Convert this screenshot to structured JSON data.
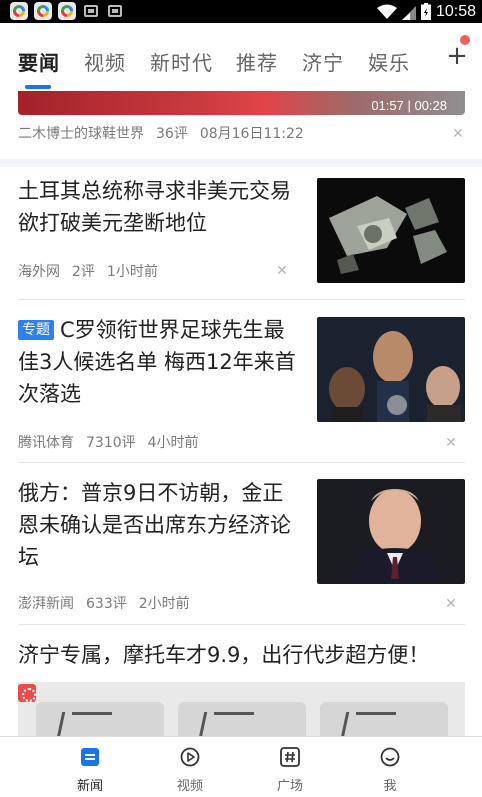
{
  "status_bar": {
    "time": "10:58"
  },
  "tabs": [
    {
      "label": "要闻",
      "active": true
    },
    {
      "label": "视频"
    },
    {
      "label": "新时代"
    },
    {
      "label": "推荐"
    },
    {
      "label": "济宁"
    },
    {
      "label": "娱乐"
    }
  ],
  "add_channel_label": "+",
  "feed": {
    "prev": {
      "duration": "01:57 | 00:28",
      "source": "二木博士的球鞋世界",
      "comments": "36评",
      "time": "08月16日11:22"
    },
    "items": [
      {
        "title": "土耳其总统称寻求非美元交易 欲打破美元垄断地位",
        "source": "海外网",
        "comments": "2评",
        "time": "1小时前"
      },
      {
        "badge": "专题",
        "title": "C罗领衔世界足球先生最佳3人候选名单 梅西12年来首次落选",
        "source": "腾讯体育",
        "comments": "7310评",
        "time": "4小时前"
      },
      {
        "title": "俄方：普京9日不访朝，金正恩未确认是否出席东方经济论坛",
        "source": "澎湃新闻",
        "comments": "633评",
        "time": "2小时前"
      }
    ],
    "ad": {
      "title": "济宁专属，摩托车才9.9，出行代步超方便！"
    }
  },
  "bottom_nav": [
    {
      "label": "新闻",
      "icon": "news-icon",
      "active": true
    },
    {
      "label": "视频",
      "icon": "play-icon"
    },
    {
      "label": "广场",
      "icon": "hashtag-icon"
    },
    {
      "label": "我",
      "icon": "smile-icon"
    }
  ],
  "colors": {
    "accent": "#1a73e8",
    "badge": "#2f80ed",
    "red_dot": "#f0605a"
  }
}
